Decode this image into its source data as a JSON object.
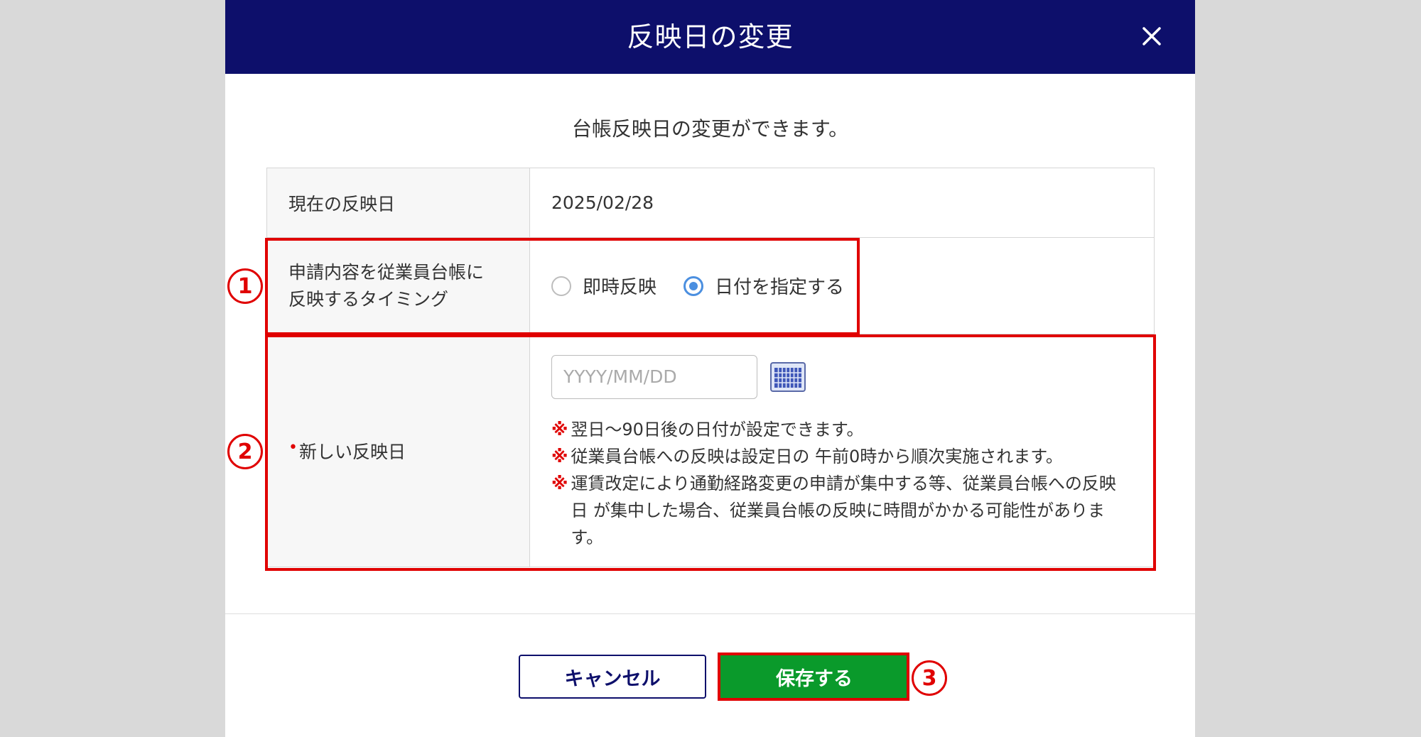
{
  "modal": {
    "title": "反映日の変更",
    "intro": "台帳反映日の変更ができます。"
  },
  "form": {
    "current_label": "現在の反映日",
    "current_value": "2025/02/28",
    "timing_label_line1": "申請内容を従業員台帳に",
    "timing_label_line2": "反映するタイミング",
    "timing_options": [
      {
        "label": "即時反映",
        "checked": false
      },
      {
        "label": "日付を指定する",
        "checked": true
      }
    ],
    "new_date_required_mark": "•",
    "new_date_label": "新しい反映日",
    "date_placeholder": "YYYY/MM/DD",
    "note_mark": "※",
    "notes": [
      "翌日～90日後の日付が設定できます。",
      "従業員台帳への反映は設定日の 午前0時から順次実施されます。",
      "運賃改定により通勤経路変更の申請が集中する等、従業員台帳への反映日 が集中した場合、従業員台帳の反映に時間がかかる可能性があります。"
    ]
  },
  "buttons": {
    "cancel": "キャンセル",
    "save": "保存する"
  },
  "annotations": {
    "n1": "1",
    "n2": "2",
    "n3": "3",
    "color": "#e00000"
  },
  "icons": {
    "close": "close-icon",
    "calendar": "calendar-icon"
  },
  "colors": {
    "header": "#0d0f6b",
    "save_button": "#0a9a2b",
    "radio_accent": "#4b8fe0"
  }
}
